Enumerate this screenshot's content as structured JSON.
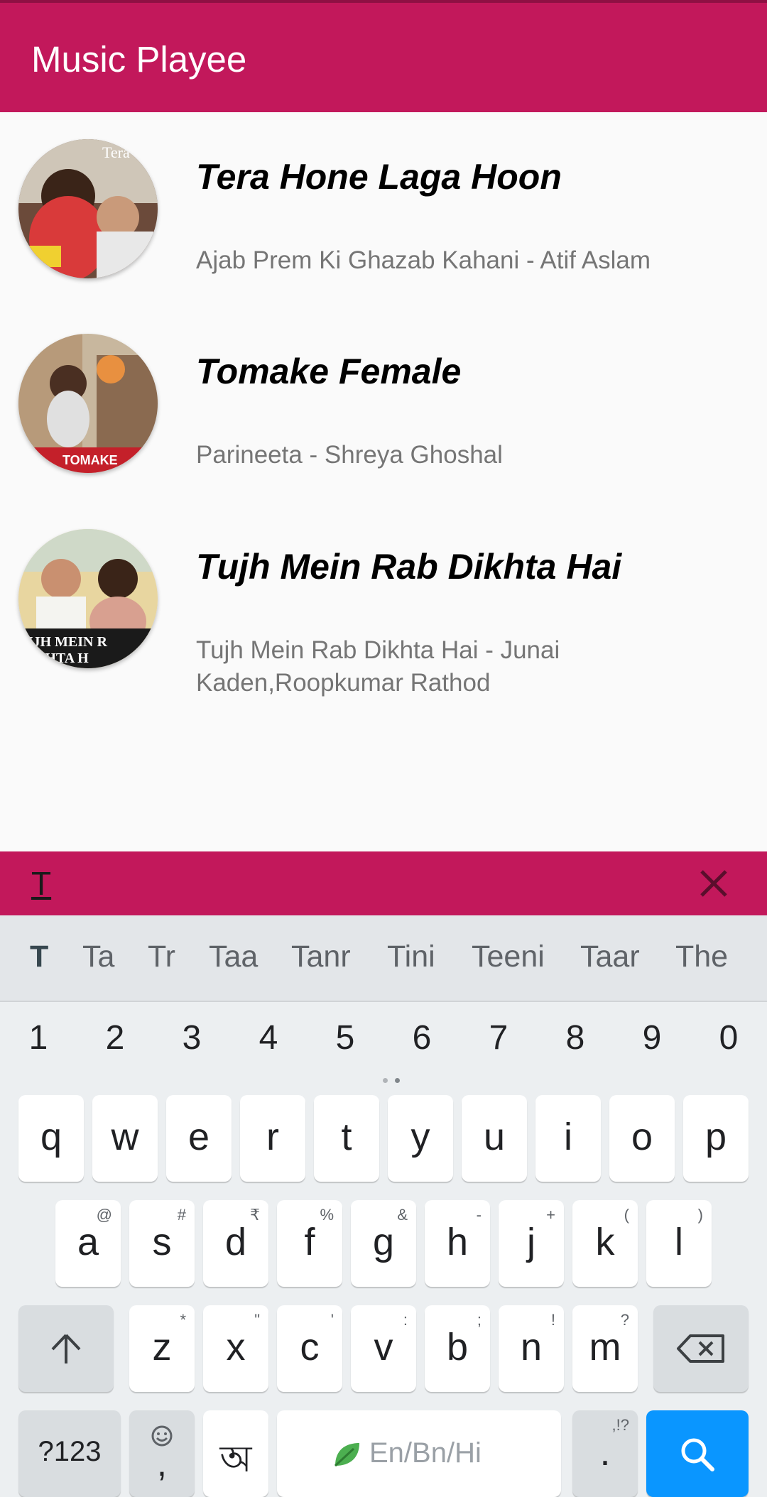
{
  "app": {
    "title": "Music Playee"
  },
  "songs": [
    {
      "title": "Tera Hone Laga Hoon",
      "subtitle": "Ajab Prem Ki Ghazab Kahani - Atif Aslam"
    },
    {
      "title": "Tomake Female",
      "subtitle": "Parineeta - Shreya Ghoshal"
    },
    {
      "title": "Tujh Mein Rab Dikhta Hai",
      "subtitle": "Tujh Mein Rab Dikhta Hai - Junai Kaden,Roopkumar Rathod"
    }
  ],
  "search": {
    "query": "T",
    "clear_icon": "close-icon"
  },
  "keyboard": {
    "suggestions": [
      "T",
      "Ta",
      "Tr",
      "Taa",
      "Tanr",
      "Tini",
      "Teeni",
      "Taar",
      "The"
    ],
    "numbers": [
      "1",
      "2",
      "3",
      "4",
      "5",
      "6",
      "7",
      "8",
      "9",
      "0"
    ],
    "row1": [
      "q",
      "w",
      "e",
      "r",
      "t",
      "y",
      "u",
      "i",
      "o",
      "p"
    ],
    "row2": [
      {
        "key": "a",
        "hint": "@"
      },
      {
        "key": "s",
        "hint": "#"
      },
      {
        "key": "d",
        "hint": "₹"
      },
      {
        "key": "f",
        "hint": "%"
      },
      {
        "key": "g",
        "hint": "&"
      },
      {
        "key": "h",
        "hint": "-"
      },
      {
        "key": "j",
        "hint": "+"
      },
      {
        "key": "k",
        "hint": "("
      },
      {
        "key": "l",
        "hint": ")"
      }
    ],
    "row3": [
      {
        "key": "z",
        "hint": "*"
      },
      {
        "key": "x",
        "hint": "\""
      },
      {
        "key": "c",
        "hint": "'"
      },
      {
        "key": "v",
        "hint": ":"
      },
      {
        "key": "b",
        "hint": ";"
      },
      {
        "key": "n",
        "hint": "!"
      },
      {
        "key": "m",
        "hint": "?"
      }
    ],
    "symbols_label": "?123",
    "comma_label": ",",
    "lang_key_label": "অ",
    "space_label": "En/Bn/Hi",
    "period_label": ".",
    "period_hint": ",!?",
    "accent_color": "#0a96ff"
  }
}
